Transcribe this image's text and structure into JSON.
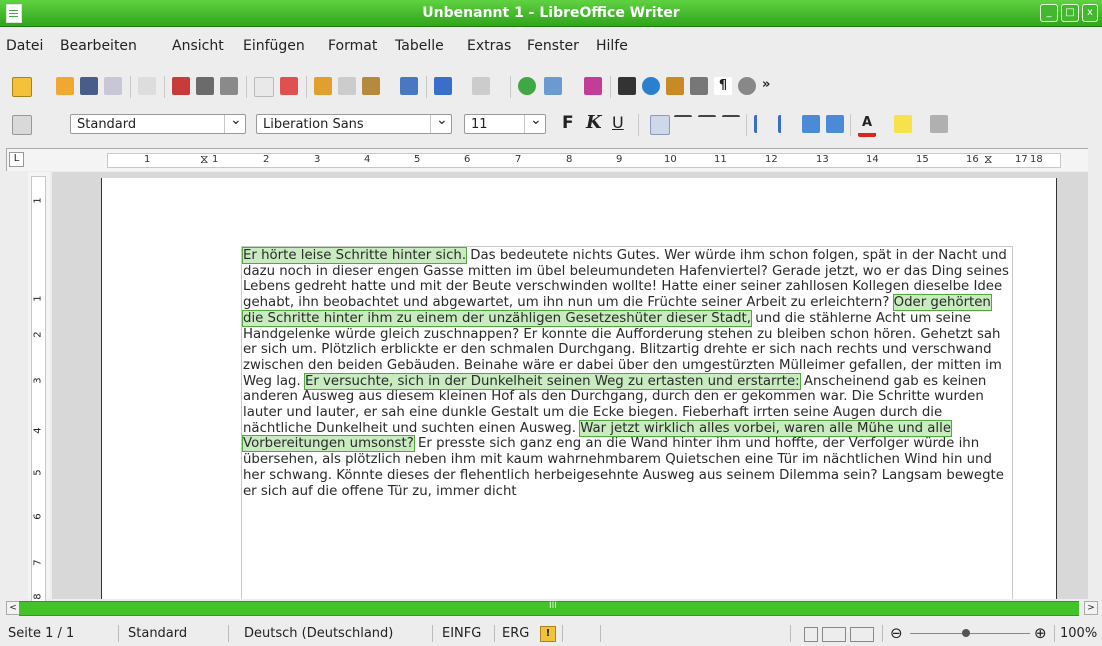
{
  "window": {
    "title": "Unbenannt 1 - LibreOffice Writer"
  },
  "menubar": {
    "items": [
      "Datei",
      "Bearbeiten",
      "Ansicht",
      "Einfügen",
      "Format",
      "Tabelle",
      "Extras",
      "Fenster",
      "Hilfe"
    ]
  },
  "format_toolbar": {
    "paragraph_style": "Standard",
    "font_name": "Liberation Sans",
    "font_size": "11",
    "bold_label": "F",
    "italic_label": "K",
    "underline_label": "U"
  },
  "ruler": {
    "numbers": [
      "1",
      "1",
      "2",
      "3",
      "4",
      "5",
      "6",
      "7",
      "8",
      "9",
      "10",
      "11",
      "12",
      "13",
      "14",
      "15",
      "16",
      "17",
      "18"
    ]
  },
  "vruler": {
    "numbers": [
      "1",
      "1",
      "2",
      "3",
      "4",
      "5",
      "6",
      "7",
      "8"
    ]
  },
  "document": {
    "segments": [
      {
        "text": "Er hörte leise Schritte hinter sich.",
        "highlight": true
      },
      {
        "text": " Das bedeutete nichts Gutes. Wer würde ihm schon folgen, spät in der Nacht und dazu noch in dieser engen Gasse mitten im übel beleumundeten Hafenviertel? Gerade jetzt, wo er das Ding seines Lebens gedreht hatte und mit der Beute verschwinden wollte! Hatte einer seiner zahllosen Kollegen dieselbe Idee gehabt, ihn beobachtet und abgewartet, um ihn nun um die Früchte seiner Arbeit zu erleichtern? ",
        "highlight": false
      },
      {
        "text": "Oder gehörten die Schritte hinter ihm zu einem der unzähligen Gesetzeshüter dieser Stadt,",
        "highlight": true
      },
      {
        "text": " und die stählerne Acht um seine Handgelenke würde gleich zuschnappen? Er konnte die Aufforderung stehen zu bleiben schon hören. Gehetzt sah er sich um. Plötzlich erblickte er den schmalen Durchgang. Blitzartig drehte er sich nach rechts und verschwand zwischen den beiden Gebäuden. Beinahe wäre er dabei über den umgestürzten Mülleimer gefallen, der mitten im Weg lag. ",
        "highlight": false
      },
      {
        "text": "Er versuchte, sich in der Dunkelheit seinen Weg zu ertasten und erstarrte:",
        "highlight": true
      },
      {
        "text": " Anscheinend gab es keinen anderen Ausweg aus diesem kleinen Hof als den Durchgang, durch den er gekommen war. Die Schritte wurden lauter und lauter, er sah eine dunkle Gestalt um die Ecke biegen. Fieberhaft irrten seine Augen durch die nächtliche Dunkelheit und suchten einen Ausweg. ",
        "highlight": false
      },
      {
        "text": "War jetzt wirklich alles vorbei, waren alle Mühe und alle Vorbereitungen umsonst?",
        "highlight": true
      },
      {
        "text": " Er presste sich ganz eng an die Wand hinter ihm und hoffte, der Verfolger würde ihn übersehen, als plötzlich neben ihm mit kaum wahrnehmbarem Quietschen eine Tür im nächtlichen Wind hin und her schwang. Könnte dieses der flehentlich herbeigesehnte Ausweg aus seinem Dilemma sein? Langsam bewegte er sich auf die offene Tür zu, immer dicht",
        "highlight": false
      }
    ]
  },
  "scrollbar": {
    "grip": "III"
  },
  "statusbar": {
    "page": "Seite 1 / 1",
    "style": "Standard",
    "language": "Deutsch (Deutschland)",
    "insert_mode": "EINFG",
    "selection_mode": "ERG",
    "zoom": "100%"
  },
  "colors": {
    "titlebar": "#3cb627",
    "highlight": "#c8ecc0",
    "highlight_border": "#4faa3a"
  }
}
